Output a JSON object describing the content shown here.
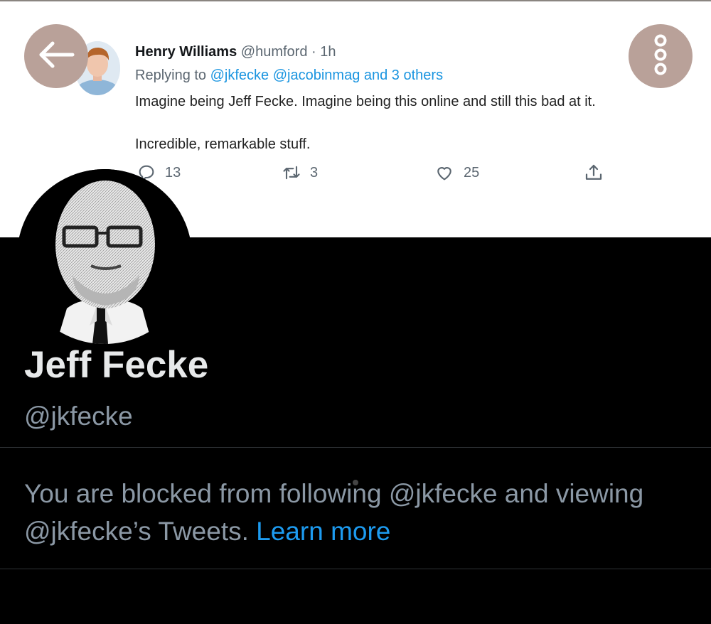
{
  "tweet": {
    "author_name": "Henry Williams",
    "author_handle": "@humford",
    "separator": "·",
    "time": "1h",
    "replying_prefix": "Replying to",
    "replying_mentions": "@jkfecke @jacobinmag and 3 others",
    "text_line1": "Imagine being Jeff Fecke. Imagine being this online and still this bad at it.",
    "text_line2": "Incredible, remarkable stuff.",
    "reply_count": "13",
    "retweet_count": "3",
    "like_count": "25"
  },
  "icons": {
    "back": "arrow-left-icon",
    "more": "vertical-dots-icon",
    "chevron": "chevron-down-icon",
    "reply": "reply-icon",
    "retweet": "retweet-icon",
    "like": "heart-icon",
    "share": "share-icon"
  },
  "profile": {
    "name": "Jeff Fecke",
    "handle": "@jkfecke",
    "blocked_text": "You are blocked from following @jkfecke and viewing @jkfecke’s Tweets.",
    "learn_more": "Learn more"
  },
  "colors": {
    "overlay_button": "#b9a199",
    "link": "#1d9bf0",
    "background": "#000000"
  }
}
